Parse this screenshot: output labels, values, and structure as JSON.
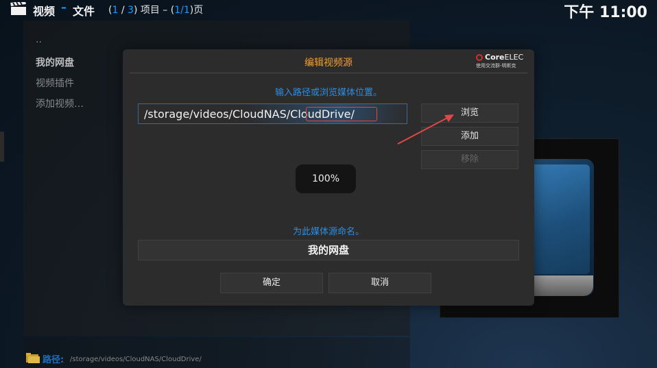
{
  "header": {
    "section": "视频",
    "separator": "–",
    "subsection": "文件",
    "paging_open": "(",
    "current_item": "1",
    "item_sep": " / ",
    "total_items": "3",
    "item_suffix": ") 项目 – (",
    "page_current_total": "1/1",
    "page_suffix": ")页",
    "clock": "下午 11:00"
  },
  "list": {
    "items": [
      {
        "label": ".."
      },
      {
        "label": "我的网盘"
      },
      {
        "label": "视频插件"
      },
      {
        "label": "添加视频…"
      }
    ]
  },
  "footer": {
    "path_label": "路径:",
    "path_value": "/storage/videos/CloudNAS/CloudDrive/"
  },
  "dialog": {
    "title": "编辑视频源",
    "brand_name": "CoreELEC",
    "brand_name_bold": "Core",
    "brand_name_thin": "ELEC",
    "brand_sub": "使用交流群-明斯克",
    "prompt_path": "输入路径或浏览媒体位置。",
    "path_value": "/storage/videos/CloudNAS/CloudDrive/",
    "browse_label": "浏览",
    "add_label": "添加",
    "remove_label": "移除",
    "progress": "100%",
    "prompt_name": "为此媒体源命名。",
    "name_value": "我的网盘",
    "ok_label": "确定",
    "cancel_label": "取消"
  },
  "colors": {
    "accent_blue": "#2a8fe6",
    "title_orange": "#f0a030",
    "annotation_red": "#e04848"
  }
}
